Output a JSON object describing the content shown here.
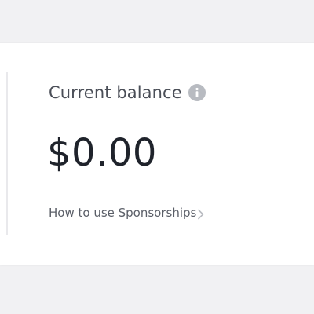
{
  "balance_card": {
    "title": "Current balance",
    "amount": "$0.00",
    "help_link": "How to use Sponsorships",
    "info_icon": "info-icon",
    "link_icon": "chevron-right-icon"
  },
  "colors": {
    "background": "#f1f1f3",
    "card": "#ffffff",
    "title_text": "#4a4e57",
    "amount_text": "#1f232b",
    "link_text": "#5b5f68",
    "icon": "#b8bbc1"
  }
}
